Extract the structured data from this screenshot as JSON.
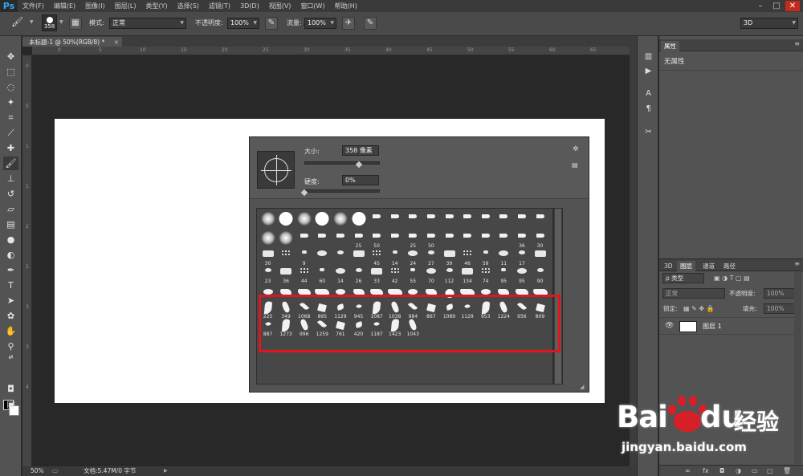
{
  "app": {
    "logo": "Ps"
  },
  "menubar": {
    "items": [
      "文件(F)",
      "编辑(E)",
      "图像(I)",
      "图层(L)",
      "类型(Y)",
      "选择(S)",
      "滤镜(T)",
      "3D(D)",
      "视图(V)",
      "窗口(W)",
      "帮助(H)"
    ]
  },
  "window_controls": {
    "minimize": "–",
    "restore": "□",
    "close": "✕"
  },
  "options": {
    "brush_size": "358",
    "mode_label": "模式:",
    "mode_value": "正常",
    "opacity_label": "不透明度:",
    "opacity_value": "100%",
    "flow_label": "流量:",
    "flow_value": "100%",
    "workspace": "3D"
  },
  "document": {
    "tab_title": "未标题-1 @ 50%(RGB/8) *",
    "zoom": "50%",
    "doc_info": "文档:5.47M/0 字节"
  },
  "ruler_h": [
    "0",
    "5",
    "10",
    "15",
    "20",
    "25",
    "30",
    "35",
    "40",
    "45",
    "50",
    "55",
    "60",
    "65",
    "70"
  ],
  "ruler_v": [
    "0",
    "5",
    "1",
    "1",
    "2",
    "2",
    "3",
    "3",
    "4"
  ],
  "brush_picker": {
    "size_label": "大小:",
    "size_value": "358 像素",
    "hardness_label": "硬度:",
    "hardness_value": "0%",
    "size_fraction": 0.72,
    "hardness_fraction": 0.0,
    "rows": [
      [
        "",
        "",
        "",
        "",
        "",
        "",
        "",
        "",
        "",
        "",
        "",
        "",
        "",
        "",
        "",
        ""
      ],
      [
        "",
        "",
        "",
        "",
        "",
        "25",
        "50",
        "",
        "25",
        "50",
        "",
        "",
        "",
        "",
        "36",
        "30"
      ],
      [
        "30",
        "",
        "9",
        "",
        "",
        "",
        "45",
        "14",
        "24",
        "27",
        "39",
        "46",
        "59",
        "11",
        "17",
        ""
      ],
      [
        "23",
        "36",
        "44",
        "60",
        "14",
        "26",
        "33",
        "42",
        "55",
        "70",
        "112",
        "134",
        "74",
        "95",
        "95",
        "90"
      ],
      [
        "",
        "",
        "",
        "",
        "",
        "",
        "",
        "",
        "",
        "",
        "",
        "",
        "",
        "",
        "",
        ""
      ],
      [
        "225",
        "349",
        "1068",
        "895",
        "1129",
        "945",
        "1087",
        "1038",
        "984",
        "867",
        "1089",
        "1129",
        "953",
        "1224",
        "956",
        "809"
      ],
      [
        "887",
        "1273",
        "996",
        "1259",
        "761",
        "420",
        "1187",
        "1423",
        "1043"
      ]
    ]
  },
  "right_panels": {
    "properties_tab": "属性",
    "properties_value": "无属性",
    "layer_tabs": [
      "3D",
      "图层",
      "通道",
      "路径"
    ],
    "kind_filter": "ρ 类型",
    "blend_mode": "正常",
    "opacity_label": "不透明度:",
    "opacity_value": "100%",
    "lock_label": "锁定:",
    "fill_label": "填充:",
    "fill_value": "100%",
    "layer_name": "图层 1"
  },
  "watermark": {
    "brand_a": "Bai",
    "brand_b": "du",
    "brand_cn": "经验",
    "url": "jingyan.baidu.com"
  }
}
